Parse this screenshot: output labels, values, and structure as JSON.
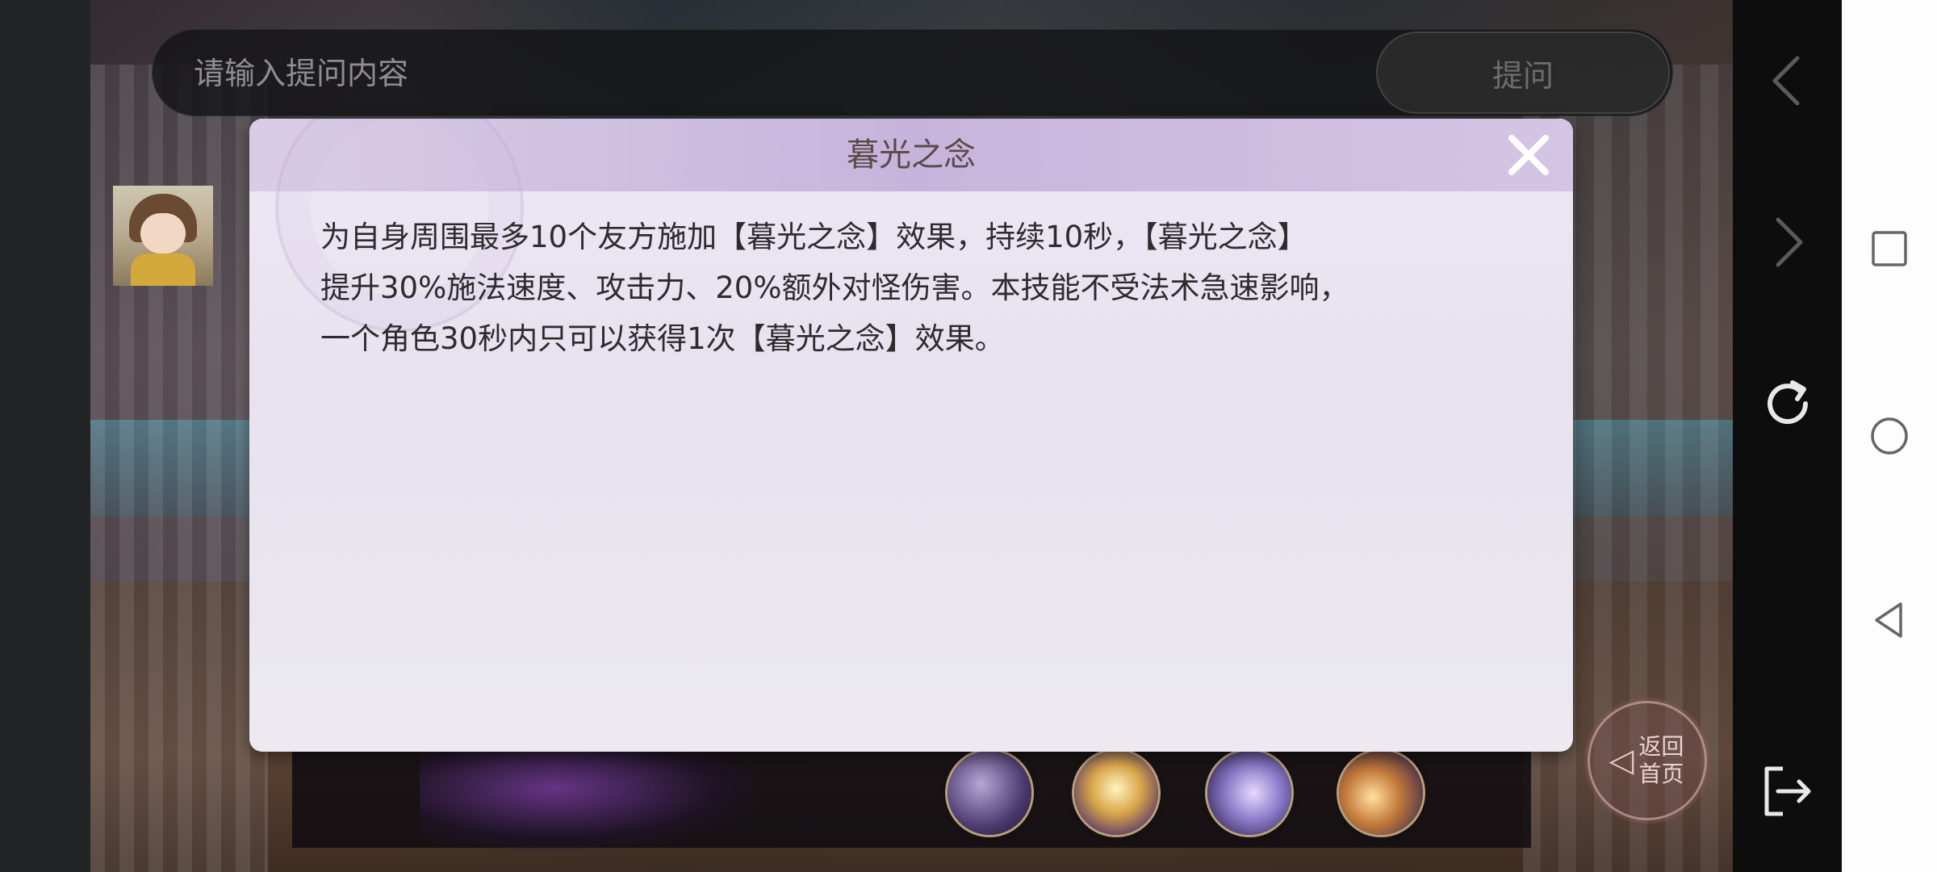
{
  "search": {
    "placeholder": "请输入提问内容",
    "button_label": "提问"
  },
  "dialog": {
    "title": "暮光之念",
    "body": "为自身周围最多10个友方施加【暮光之念】效果，持续10秒，【暮光之念】\n提升30%施法速度、攻击力、20%额外对怪伤害。本技能不受法术急速影响，\n一个角色30秒内只可以获得1次【暮光之念】效果。",
    "close_icon": "close-icon"
  },
  "return_home": {
    "line1": "返回",
    "line2": "首页"
  },
  "game_nav": {
    "icons": [
      "chevron-left-icon",
      "chevron-right-icon",
      "refresh-icon",
      "exit-icon"
    ]
  },
  "system_nav": {
    "icons": [
      "recent-apps-icon",
      "home-icon",
      "back-icon"
    ]
  },
  "colors": {
    "dialog_header": "#c7b4dc",
    "dialog_body": "#ece8f1",
    "title_text": "#5a4a4a"
  }
}
